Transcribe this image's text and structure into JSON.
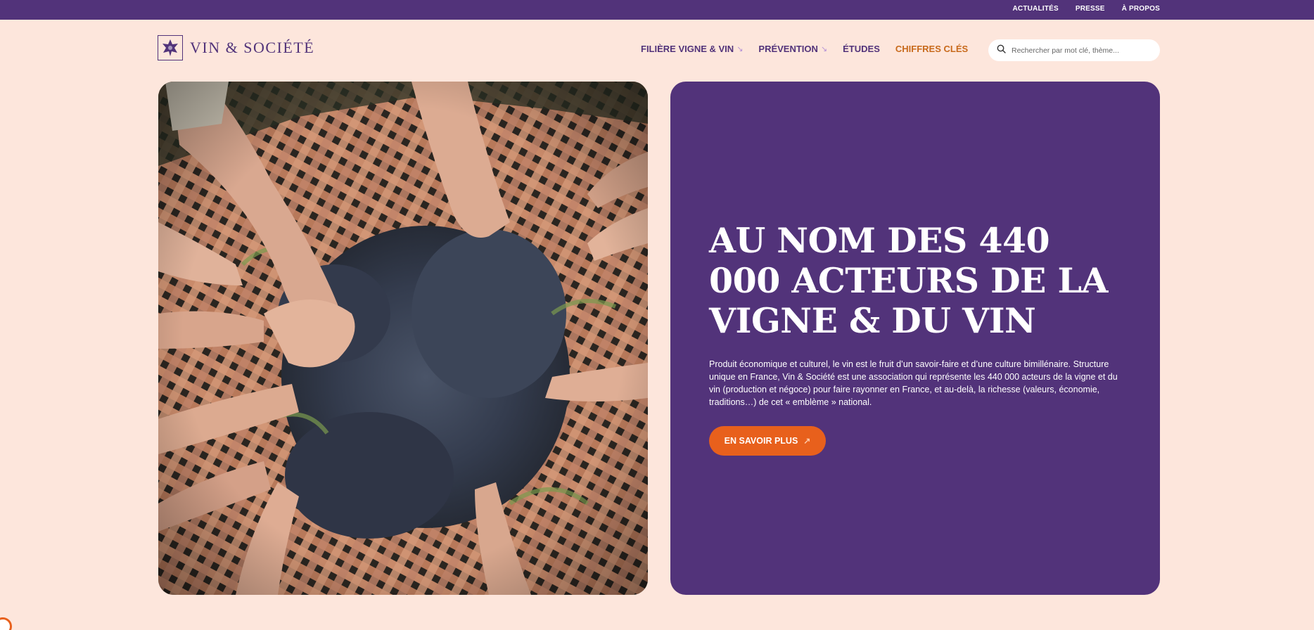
{
  "topbar": {
    "links": [
      "ACTUALITÉS",
      "PRESSE",
      "À PROPOS"
    ]
  },
  "logo": {
    "text": "VIN & SOCIÉTÉ",
    "icon": "grape-leaf-icon"
  },
  "nav": {
    "items": [
      {
        "label": "FILIÈRE VIGNE & VIN",
        "arrow": "↘"
      },
      {
        "label": "PRÉVENTION",
        "arrow": "↘"
      },
      {
        "label": "ÉTUDES",
        "arrow": ""
      },
      {
        "label": "CHIFFRES CLÉS",
        "arrow": ""
      }
    ]
  },
  "search": {
    "placeholder": "Rechercher par mot clé, thème...",
    "icon": "search-icon"
  },
  "hero": {
    "title": "AU NOM DES 440 000 ACTEURS DE LA VIGNE & DU VIN",
    "text": "Produit économique et culturel, le vin est le fruit d’un savoir-faire et d’une culture bimillénaire. Structure unique en France, Vin & Société est une association qui représente les 440 000 acteurs de la vigne et du vin (production et négoce) pour faire rayonner en France, et au-delà, la richesse (valeurs, économie, traditions…) de cet « emblème » national.",
    "cta_label": "EN SAVOIR PLUS",
    "cta_arrow": "↗"
  },
  "colors": {
    "background": "#fde6dc",
    "brand_purple": "#52337a",
    "accent_orange": "#e8601c",
    "nav_accent": "#c86a1c"
  }
}
